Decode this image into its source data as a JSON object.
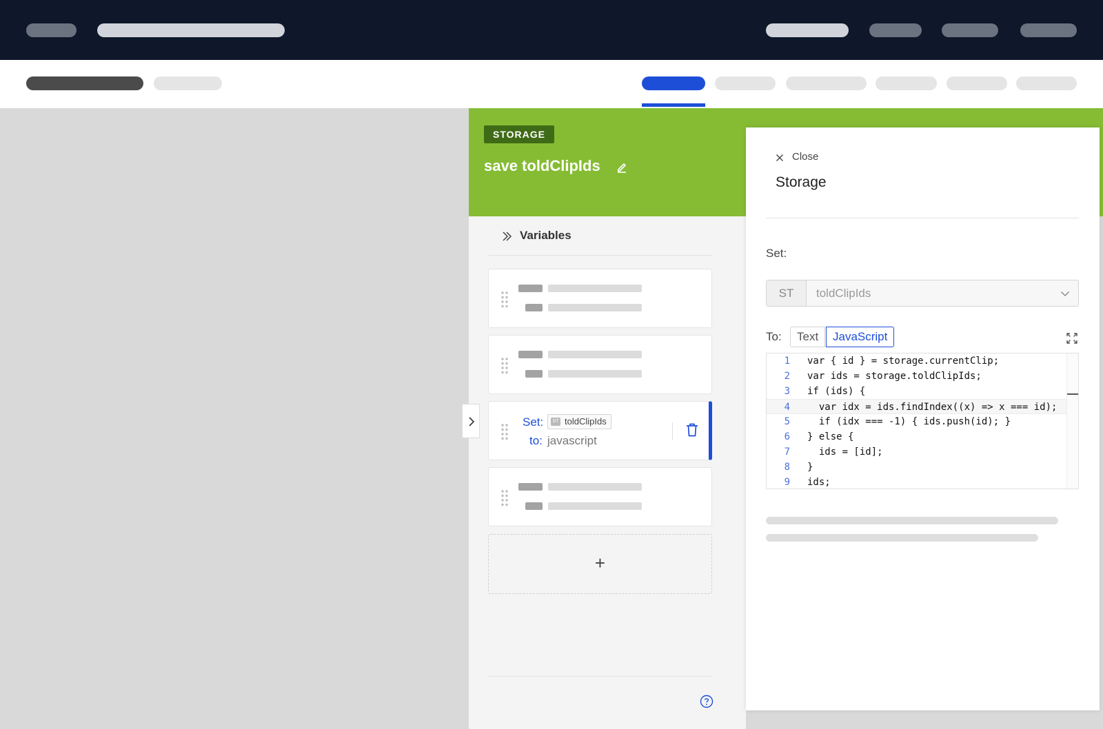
{
  "colors": {
    "nav_bg": "#0f172a",
    "accent": "#1d4ed8",
    "node_green": "#86bc34",
    "badge_green": "#3f6b16"
  },
  "node": {
    "badge": "STORAGE",
    "title": "save toldClipIds"
  },
  "variables": {
    "header": "Variables",
    "active_card": {
      "set_label": "Set:",
      "chip_prefix": "ST",
      "chip_value": "toldClipIds",
      "to_label": "to:",
      "to_value": "javascript"
    },
    "add_label": "+"
  },
  "side_panel": {
    "close_label": "Close",
    "title": "Storage",
    "set_label": "Set:",
    "select": {
      "prefix": "ST",
      "value": "toldClipIds"
    },
    "to_label": "To:",
    "toggle": {
      "text_label": "Text",
      "js_label": "JavaScript",
      "selected": "JavaScript"
    },
    "code_lines": [
      {
        "num": "1",
        "text": "var { id } = storage.currentClip;"
      },
      {
        "num": "2",
        "text": "var ids = storage.toldClipIds;"
      },
      {
        "num": "3",
        "text": "if (ids) {"
      },
      {
        "num": "4",
        "text": "  var idx = ids.findIndex((x) => x === id);"
      },
      {
        "num": "5",
        "text": "  if (idx === -1) { ids.push(id); }"
      },
      {
        "num": "6",
        "text": "} else {"
      },
      {
        "num": "7",
        "text": "  ids = [id];"
      },
      {
        "num": "8",
        "text": "}"
      },
      {
        "num": "9",
        "text": "ids;"
      }
    ]
  }
}
